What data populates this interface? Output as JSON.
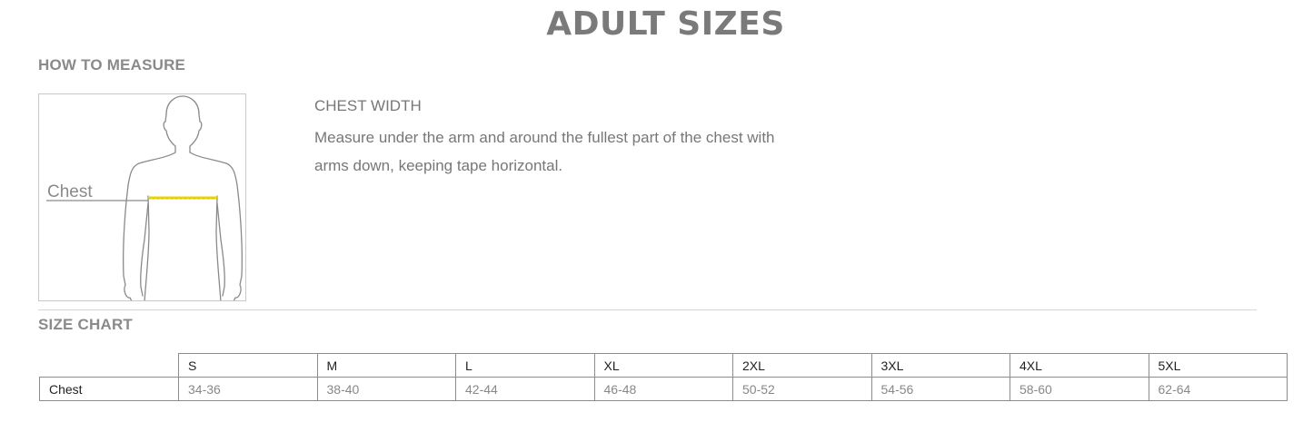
{
  "page": {
    "title": "ADULT SIZES"
  },
  "how_to_measure": {
    "heading": "HOW TO MEASURE",
    "figure_label": "Chest",
    "measure_title": "CHEST WIDTH",
    "measure_description": "Measure under the arm and around the fullest part of the chest with arms down, keeping tape horizontal.",
    "figure_icon": "body-outline-icon",
    "tape_color": "#e8d600"
  },
  "size_chart": {
    "heading": "SIZE CHART",
    "columns": [
      "S",
      "M",
      "L",
      "XL",
      "2XL",
      "3XL",
      "4XL",
      "5XL"
    ],
    "rows": [
      {
        "label": "Chest",
        "values": [
          "34-36",
          "38-40",
          "42-44",
          "46-48",
          "50-52",
          "54-56",
          "58-60",
          "62-64"
        ]
      }
    ]
  }
}
